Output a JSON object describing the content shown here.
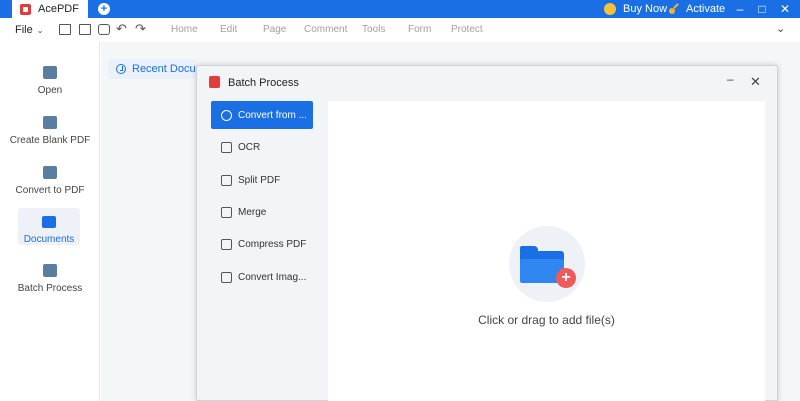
{
  "app": {
    "name": "AcePDF"
  },
  "titlebar": {
    "new_tab_symbol": "+",
    "buy_now": "Buy Now",
    "activate": "Activate",
    "minimize": "–",
    "maximize": "□",
    "close": "✕"
  },
  "menubar": {
    "file": "File",
    "tabs": [
      "Home",
      "Edit",
      "Page",
      "Comment",
      "Tools",
      "Form",
      "Protect"
    ]
  },
  "sidebar": {
    "items": [
      {
        "label": "Open",
        "icon": "folder-icon"
      },
      {
        "label": "Create Blank PDF",
        "icon": "file-plus-icon"
      },
      {
        "label": "Convert to PDF",
        "icon": "convert-icon"
      },
      {
        "label": "Documents",
        "icon": "documents-icon",
        "active": true
      },
      {
        "label": "Batch Process",
        "icon": "batch-icon"
      }
    ]
  },
  "recent": {
    "label": "Recent Docum"
  },
  "dialog": {
    "title": "Batch Process",
    "minimize": "–",
    "close": "✕",
    "operations": [
      {
        "label": "Convert from ...",
        "icon": "refresh-icon",
        "active": true
      },
      {
        "label": "OCR",
        "icon": "ocr-icon"
      },
      {
        "label": "Split PDF",
        "icon": "split-icon"
      },
      {
        "label": "Merge",
        "icon": "merge-icon"
      },
      {
        "label": "Compress PDF",
        "icon": "compress-icon"
      },
      {
        "label": "Convert Imag...",
        "icon": "image-convert-icon"
      }
    ],
    "drop_text": "Click or drag to add file(s)",
    "plus": "+"
  },
  "colors": {
    "accent": "#1b6fe5",
    "badge": "#f05a5a"
  }
}
